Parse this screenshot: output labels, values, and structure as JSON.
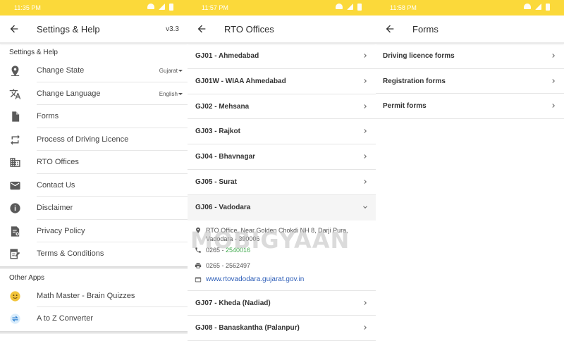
{
  "colors": {
    "status_bar": "#fbd93a",
    "link": "#2f5fb8",
    "phone_highlight": "#3da84a"
  },
  "screen1": {
    "status_time": "11:35 PM",
    "title": "Settings & Help",
    "version": "v3.3",
    "section_settings": "Settings & Help",
    "items": [
      {
        "icon": "location-pin-icon",
        "label": "Change State",
        "value": "Gujarat"
      },
      {
        "icon": "translate-icon",
        "label": "Change Language",
        "value": "English"
      },
      {
        "icon": "document-icon",
        "label": "Forms"
      },
      {
        "icon": "swap-arrows-icon",
        "label": "Process of Driving Licence"
      },
      {
        "icon": "building-icon",
        "label": "RTO Offices"
      },
      {
        "icon": "mail-icon",
        "label": "Contact Us"
      },
      {
        "icon": "info-icon",
        "label": "Disclaimer"
      },
      {
        "icon": "policy-icon",
        "label": "Privacy Policy"
      },
      {
        "icon": "edit-note-icon",
        "label": "Terms & Conditions"
      }
    ],
    "section_other": "Other Apps",
    "other_apps": [
      {
        "icon": "math-master-app-icon",
        "label": "Math Master - Brain Quizzes"
      },
      {
        "icon": "converter-app-icon",
        "label": "A to Z Converter"
      }
    ]
  },
  "screen2": {
    "status_time": "11:57 PM",
    "title": "RTO Offices",
    "offices_top": [
      "GJ01 - Ahmedabad",
      "GJ01W - WIAA Ahmedabad",
      "GJ02 - Mehsana",
      "GJ03 - Rajkot",
      "GJ04 - Bhavnagar",
      "GJ05 - Surat"
    ],
    "expanded": {
      "name": "GJ06 - Vadodara",
      "address": "RTO Office, Near Golden Chokdi NH 8, Darji Pura, Vadodara - 390006",
      "phone_prefix": "0265 - ",
      "phone_number": "2540016",
      "fax": "0265 - 2562497",
      "website": "www.rtovadodara.gujarat.gov.in"
    },
    "offices_bottom": [
      "GJ07 - Kheda (Nadiad)",
      "GJ08 - Banaskantha (Palanpur)"
    ],
    "watermark": "MOBIGYAAN"
  },
  "screen3": {
    "status_time": "11:58 PM",
    "title": "Forms",
    "forms": [
      "Driving licence forms",
      "Registration forms",
      "Permit forms"
    ]
  }
}
